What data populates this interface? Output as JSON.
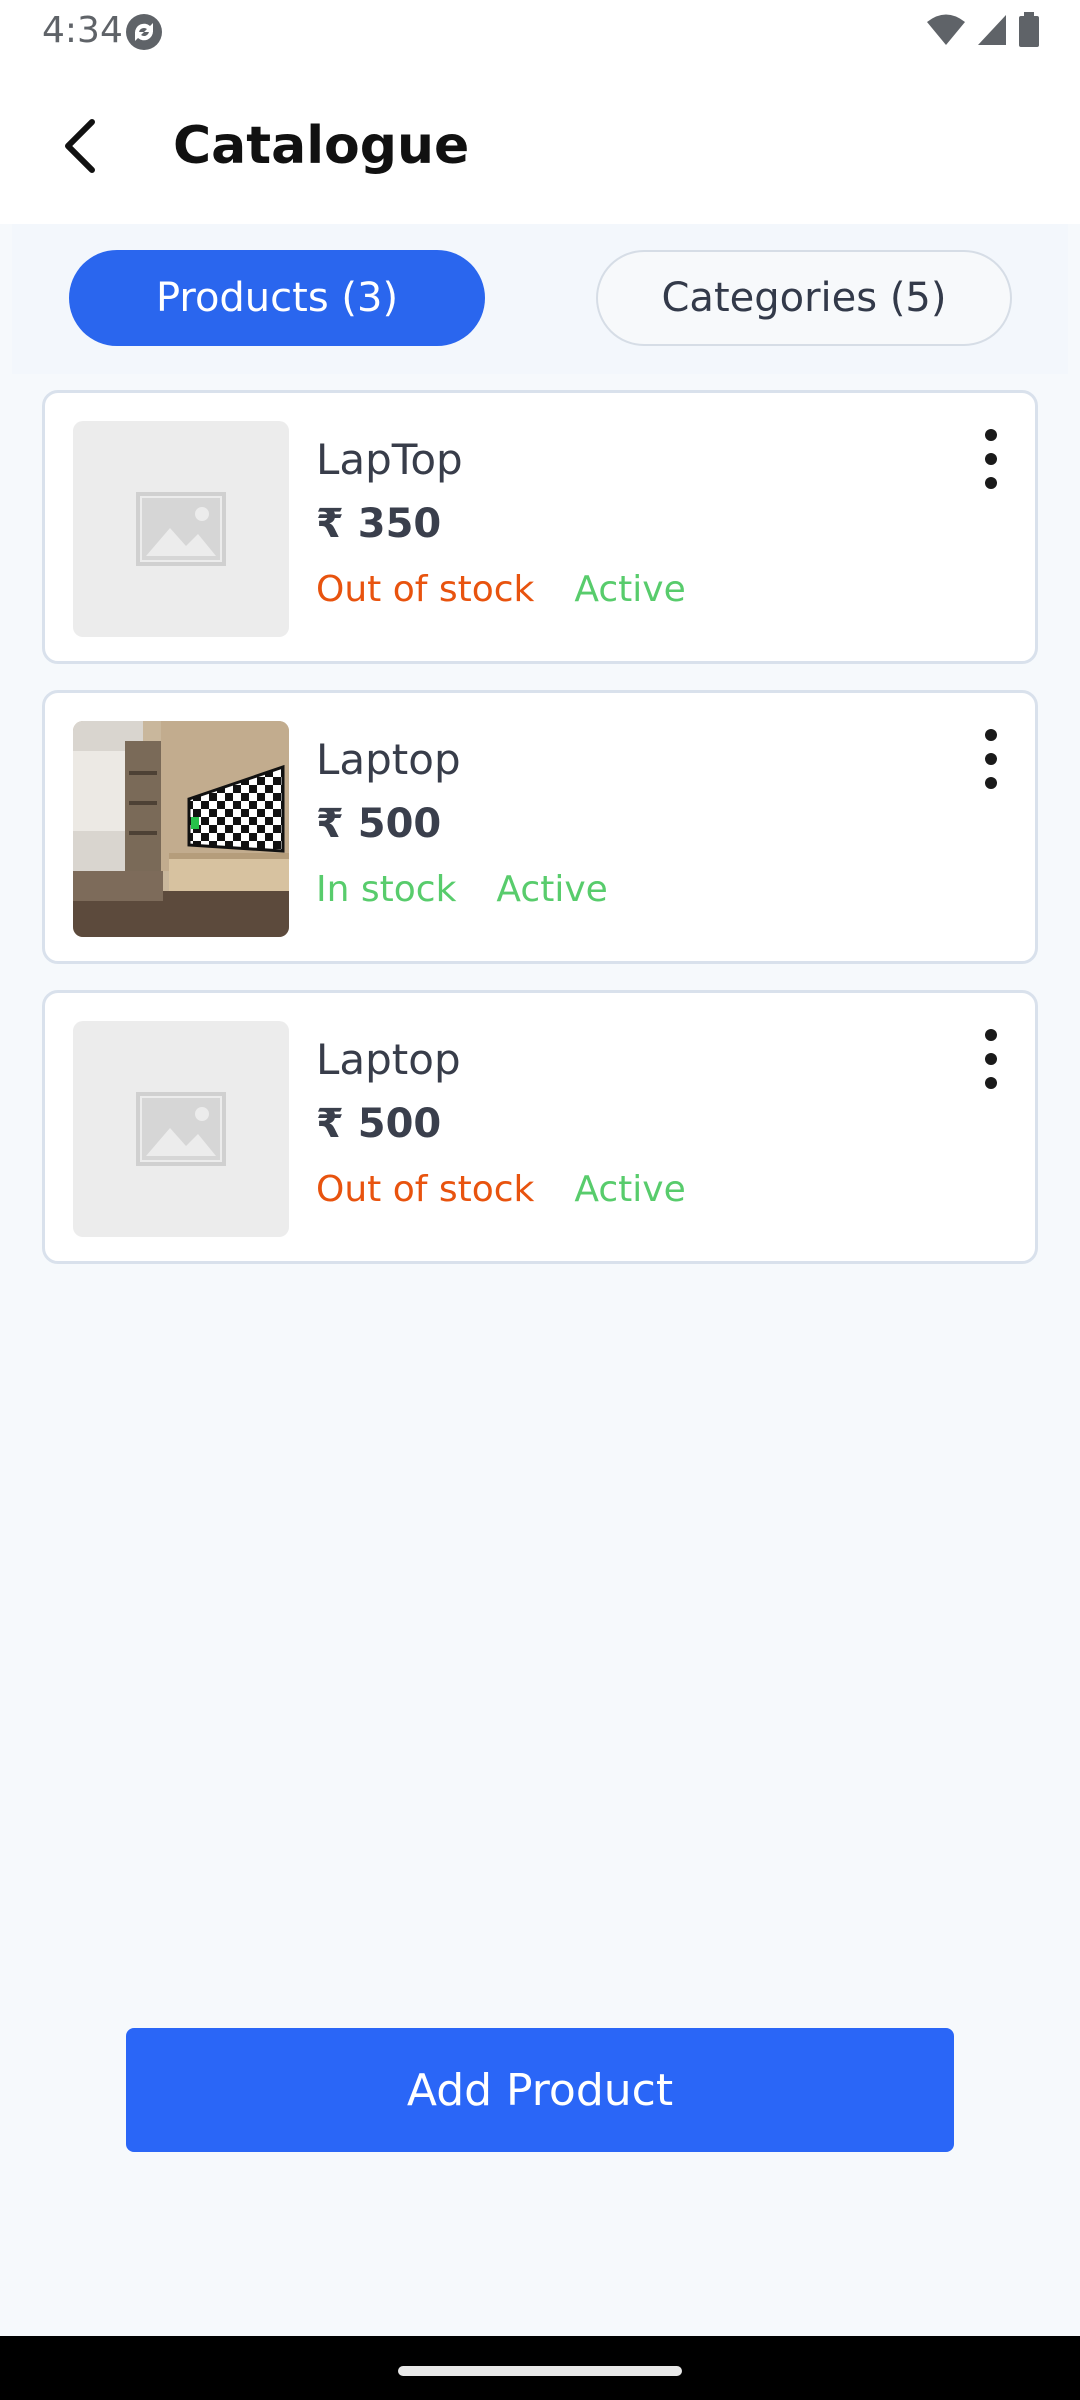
{
  "status": {
    "time": "4:34"
  },
  "header": {
    "title": "Catalogue"
  },
  "tabs": [
    {
      "label": "Products (3)",
      "selected": true
    },
    {
      "label": "Categories (5)",
      "selected": false
    }
  ],
  "products": [
    {
      "name": "LapTop",
      "price": "₹ 350",
      "stock": "Out of stock",
      "status": "Active",
      "image": "placeholder-image-icon"
    },
    {
      "name": "Laptop",
      "price": "₹ 500",
      "stock": "In stock",
      "status": "Active",
      "image": "room-photo"
    },
    {
      "name": "Laptop",
      "price": "₹ 500",
      "stock": "Out of stock",
      "status": "Active",
      "image": "placeholder-image-icon"
    }
  ],
  "footer": {
    "add_label": "Add Product"
  },
  "colors": {
    "primary": "#2a66ee",
    "out_of_stock": "#e8530e",
    "in_stock": "#58cc6c",
    "active": "#58cc6c"
  }
}
